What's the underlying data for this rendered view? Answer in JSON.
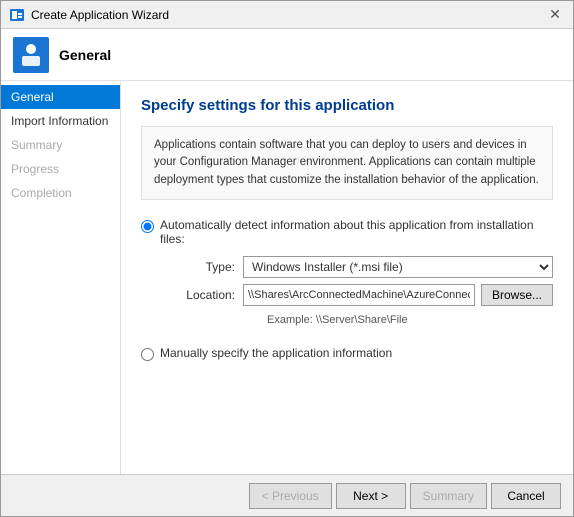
{
  "dialog": {
    "title": "Create Application Wizard",
    "header_title": "General"
  },
  "sidebar": {
    "items": [
      {
        "label": "General",
        "state": "active"
      },
      {
        "label": "Import Information",
        "state": "normal"
      },
      {
        "label": "Summary",
        "state": "disabled"
      },
      {
        "label": "Progress",
        "state": "disabled"
      },
      {
        "label": "Completion",
        "state": "disabled"
      }
    ]
  },
  "content": {
    "title": "Specify settings for this application",
    "description": "Applications contain software that you can deploy to users and devices in your Configuration Manager environment. Applications can contain multiple deployment types that customize the installation behavior of the application.",
    "auto_detect_label": "Automatically detect information about this application from installation files:",
    "type_label": "Type:",
    "type_value": "Windows Installer (*.msi file)",
    "location_label": "Location:",
    "location_value": "\\\\Shares\\ArcConnectedMachine\\AzureConnectedMachineAgent.msi",
    "example_text": "Example: \\\\Server\\Share\\File",
    "browse_label": "Browse...",
    "manual_label": "Manually specify the application information"
  },
  "footer": {
    "prev_label": "< Previous",
    "next_label": "Next >",
    "summary_label": "Summary",
    "cancel_label": "Cancel"
  }
}
